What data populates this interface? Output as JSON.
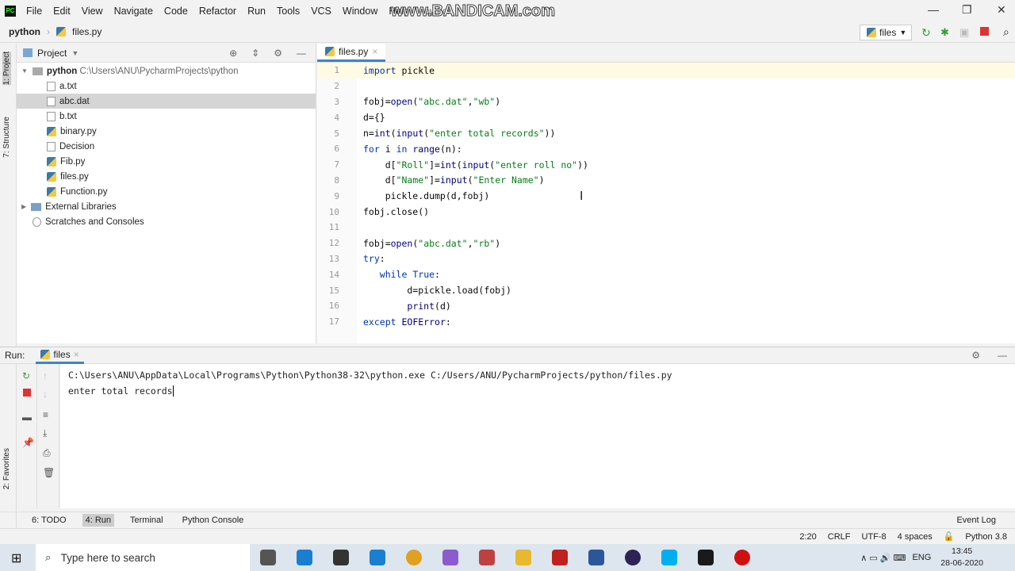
{
  "menu": [
    "File",
    "Edit",
    "View",
    "Navigate",
    "Code",
    "Refactor",
    "Run",
    "Tools",
    "VCS",
    "Window",
    "Help"
  ],
  "window_title": "python",
  "watermark": "www.BANDICAM.com",
  "breadcrumb": {
    "project": "python",
    "file": "files.py"
  },
  "run_config": "files",
  "side_tabs": {
    "project": "1: Project",
    "structure": "7: Structure",
    "favorites": "2: Favorites"
  },
  "project_panel": {
    "title": "Project",
    "root": "python",
    "root_path": "C:\\Users\\ANU\\PycharmProjects\\python",
    "files": [
      "a.txt",
      "abc.dat",
      "b.txt",
      "binary.py",
      "Decision",
      "Fib.py",
      "files.py",
      "Function.py"
    ],
    "selected": "abc.dat",
    "external": "External Libraries",
    "scratches": "Scratches and Consoles"
  },
  "editor": {
    "tab": "files.py",
    "lines": [
      [
        [
          "import",
          "kw"
        ],
        [
          " pickle",
          "plain"
        ]
      ],
      [],
      [
        [
          "fobj=",
          "plain"
        ],
        [
          "open",
          "fn"
        ],
        [
          "(",
          "plain"
        ],
        [
          "\"abc.dat\"",
          "str"
        ],
        [
          ",",
          "plain"
        ],
        [
          "\"wb\"",
          "str"
        ],
        [
          ")",
          "plain"
        ]
      ],
      [
        [
          "d={}",
          "plain"
        ]
      ],
      [
        [
          "n=",
          "plain"
        ],
        [
          "int",
          "fn"
        ],
        [
          "(",
          "plain"
        ],
        [
          "input",
          "fn"
        ],
        [
          "(",
          "plain"
        ],
        [
          "\"enter total records\"",
          "str"
        ],
        [
          "))",
          "plain"
        ]
      ],
      [
        [
          "for",
          "kw"
        ],
        [
          " i ",
          "plain"
        ],
        [
          "in",
          "kw"
        ],
        [
          " ",
          "plain"
        ],
        [
          "range",
          "fn"
        ],
        [
          "(n):",
          "plain"
        ]
      ],
      [
        [
          "    d[",
          "plain"
        ],
        [
          "\"Roll\"",
          "str"
        ],
        [
          "]=",
          "plain"
        ],
        [
          "int",
          "fn"
        ],
        [
          "(",
          "plain"
        ],
        [
          "input",
          "fn"
        ],
        [
          "(",
          "plain"
        ],
        [
          "\"enter roll no\"",
          "str"
        ],
        [
          "))",
          "plain"
        ]
      ],
      [
        [
          "    d[",
          "plain"
        ],
        [
          "\"Name\"",
          "str"
        ],
        [
          "]=",
          "plain"
        ],
        [
          "input",
          "fn"
        ],
        [
          "(",
          "plain"
        ],
        [
          "\"Enter Name\"",
          "str"
        ],
        [
          ")",
          "plain"
        ]
      ],
      [
        [
          "    pickle.dump(d,fobj)",
          "plain"
        ]
      ],
      [
        [
          "fobj.close()",
          "plain"
        ]
      ],
      [],
      [
        [
          "fobj=",
          "plain"
        ],
        [
          "open",
          "fn"
        ],
        [
          "(",
          "plain"
        ],
        [
          "\"abc.dat\"",
          "str"
        ],
        [
          ",",
          "plain"
        ],
        [
          "\"rb\"",
          "str"
        ],
        [
          ")",
          "plain"
        ]
      ],
      [
        [
          "try",
          "kw"
        ],
        [
          ":",
          "plain"
        ]
      ],
      [
        [
          "   ",
          "plain"
        ],
        [
          "while",
          "kw"
        ],
        [
          " ",
          "plain"
        ],
        [
          "True",
          "kw"
        ],
        [
          ":",
          "plain"
        ]
      ],
      [
        [
          "        d=pickle.load(fobj)",
          "plain"
        ]
      ],
      [
        [
          "        ",
          "plain"
        ],
        [
          "print",
          "fn"
        ],
        [
          "(d)",
          "plain"
        ]
      ],
      [
        [
          "except",
          "kw"
        ],
        [
          " ",
          "plain"
        ],
        [
          "EOFError",
          "fn"
        ],
        [
          ":",
          "plain"
        ]
      ]
    ]
  },
  "run": {
    "label": "Run:",
    "tab": "files",
    "command": "C:\\Users\\ANU\\AppData\\Local\\Programs\\Python\\Python38-32\\python.exe C:/Users/ANU/PycharmProjects/python/files.py",
    "output": "enter total records"
  },
  "tool_windows": [
    "6: TODO",
    "4: Run",
    "Terminal",
    "Python Console"
  ],
  "event_log": "Event Log",
  "status": {
    "position": "2:20",
    "line_sep": "CRLF",
    "encoding": "UTF-8",
    "indent": "4 spaces",
    "interpreter": "Python 3.8"
  },
  "taskbar": {
    "search_placeholder": "Type here to search",
    "lang": "ENG",
    "time": "13:45",
    "date": "28-06-2020"
  }
}
